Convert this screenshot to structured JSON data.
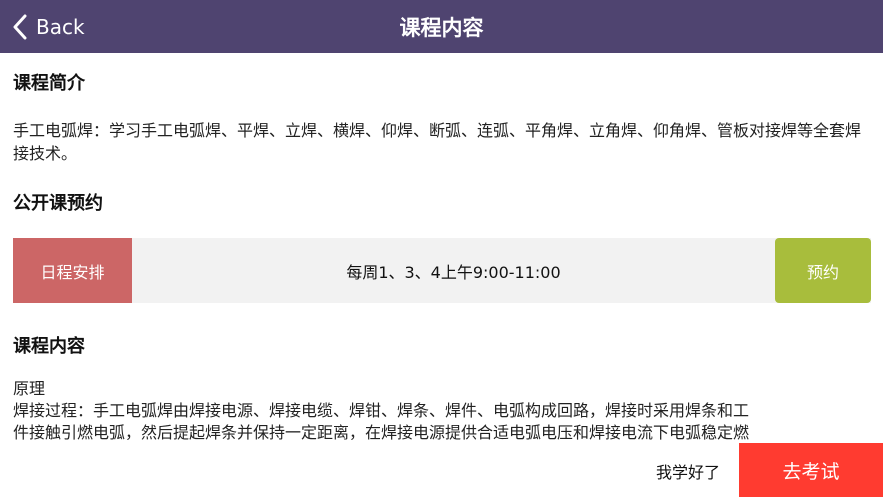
{
  "header": {
    "back_label": "Back",
    "title": "课程内容",
    "bg_color": "#4f4470"
  },
  "intro": {
    "heading": "课程简介",
    "text": "手工电弧焊：学习手工电弧焊、平焊、立焊、横焊、仰焊、断弧、连弧、平角焊、立角焊、仰角焊、管板对接焊等全套焊接技术。"
  },
  "open_class": {
    "heading": "公开课预约",
    "schedule_label": "日程安排",
    "schedule_time": "每周1、3、4上午9:00-11:00",
    "reserve_label": "预约",
    "label_color": "#cc6666",
    "reserve_color": "#a8bd3c"
  },
  "content": {
    "heading": "课程内容",
    "line1": "原理",
    "line2": "焊接过程：手工电弧焊由焊接电源、焊接电缆、焊钳、焊条、焊件、电弧构成回路，焊接时采用焊条和工",
    "line3": "件接触引燃电弧，然后提起焊条并保持一定距离，在焊接电源提供合适电弧电压和焊接电流下电弧稳定燃"
  },
  "footer": {
    "learned_label": "我学好了",
    "exam_label": "去考试",
    "exam_color": "#ff3b30"
  }
}
